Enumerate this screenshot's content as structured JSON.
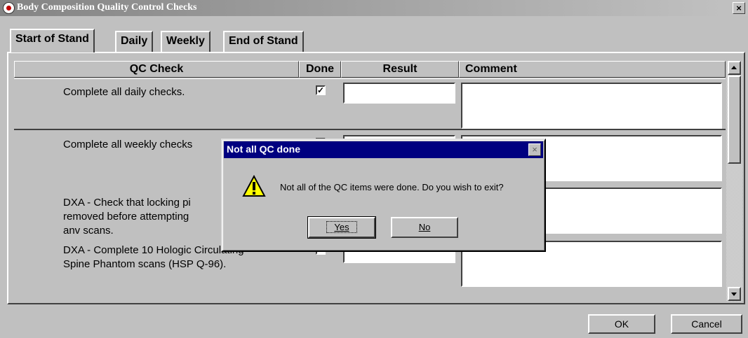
{
  "window": {
    "title": "Body Composition Quality Control Checks",
    "close_glyph": "×"
  },
  "tabs": [
    {
      "label": "Start of Stand",
      "active": true
    },
    {
      "label": "Daily",
      "active": false
    },
    {
      "label": "Weekly",
      "active": false
    },
    {
      "label": "End of Stand",
      "active": false
    }
  ],
  "grid": {
    "headers": {
      "qc_check": "QC Check",
      "done": "Done",
      "result": "Result",
      "comment": "Comment"
    },
    "rows": [
      {
        "text": "Complete all daily checks.",
        "done": true,
        "done_glyph": "✓",
        "result": "",
        "comment": ""
      },
      {
        "text": "Complete all weekly checks",
        "done": false,
        "result": "",
        "comment": ""
      },
      {
        "text": "DXA - Check that locking pin removed before attempting any scans.",
        "visible_text": "DXA - Check that locking pi\nremoved before attempting\nanv scans.",
        "done": false,
        "result": "",
        "comment": ""
      },
      {
        "text": "DXA - Complete 10 Hologic Circulating Spine Phantom scans (HSP Q-96).",
        "visible_text": "DXA - Complete 10 Hologic Circulating\nSpine Phantom scans (HSP Q-96).",
        "done": false,
        "result": "",
        "comment": ""
      }
    ]
  },
  "buttons": {
    "ok": "OK",
    "cancel": "Cancel"
  },
  "dialog": {
    "title": "Not all QC done",
    "message": "Not all of the QC items were done. Do you wish to exit?",
    "yes": "Yes",
    "no": "No",
    "icon": "warning-icon",
    "close_glyph": "×"
  },
  "colors": {
    "dialog_title_bg": "#000080",
    "window_bg": "#c0c0c0"
  }
}
